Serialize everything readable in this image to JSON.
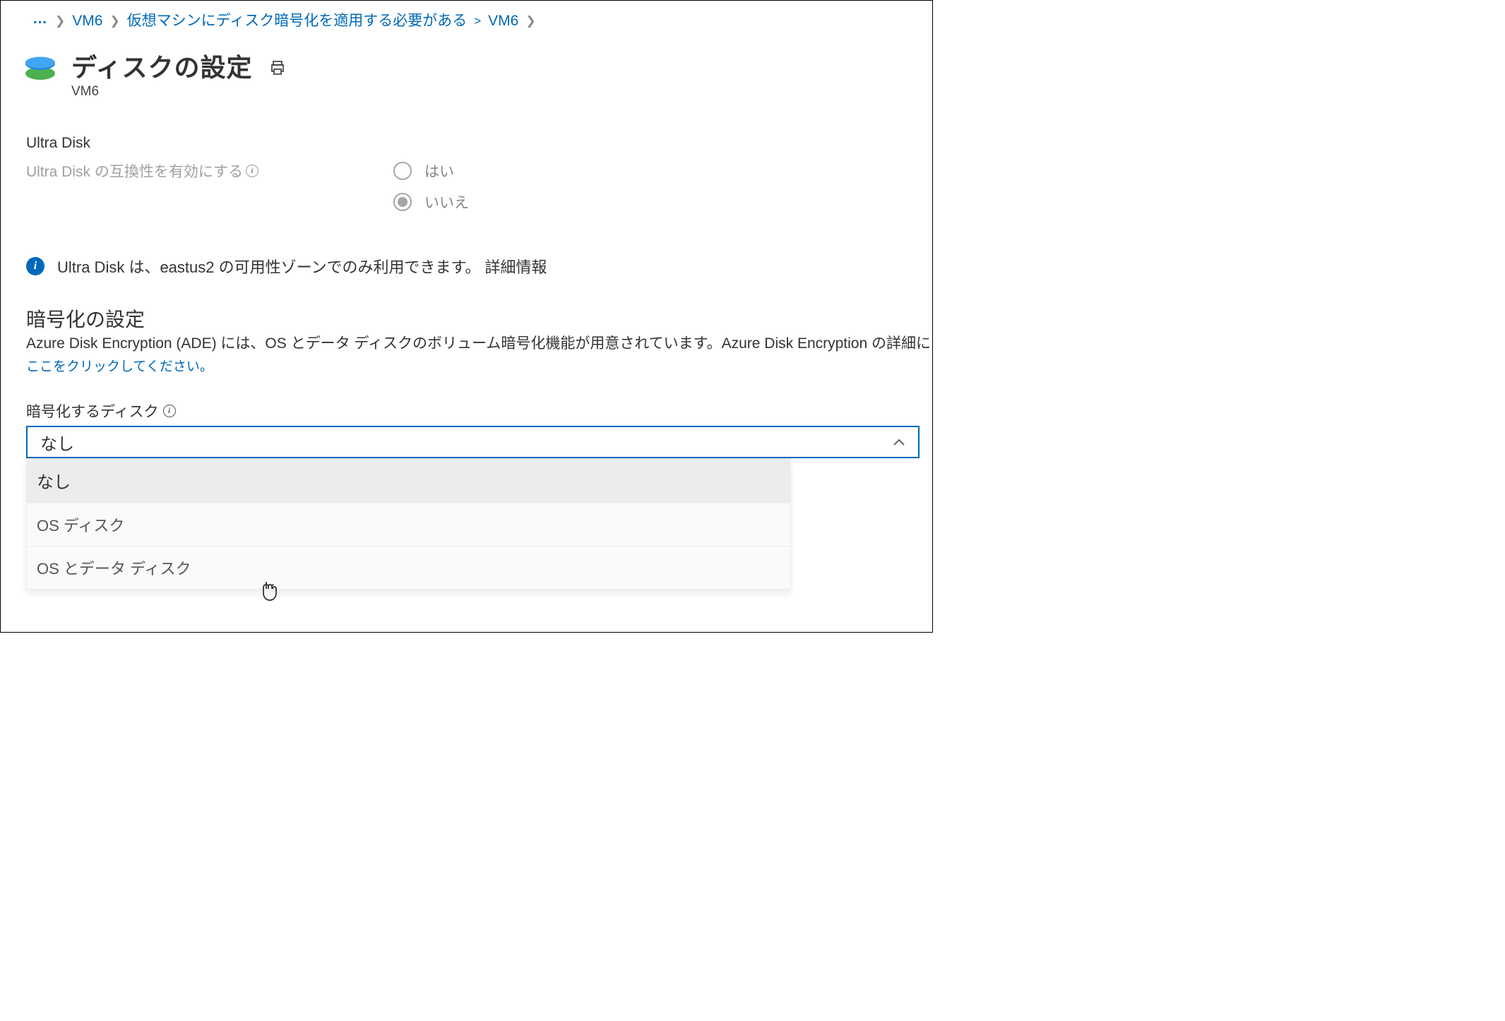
{
  "breadcrumb": {
    "dots": "…",
    "item1": "VM6",
    "item2": "仮想マシンにディスク暗号化を適用する必要がある",
    "item3": "VM6"
  },
  "header": {
    "title": "ディスクの設定",
    "subtitle": "VM6"
  },
  "ultra": {
    "heading": "Ultra Disk",
    "label": "Ultra Disk の互換性を有効にする",
    "yes": "はい",
    "no": "いいえ",
    "selected": "no"
  },
  "info": {
    "text": "Ultra Disk は、eastus2 の可用性ゾーンでのみ利用できます。 詳細情報"
  },
  "encryption": {
    "heading": "暗号化の設定",
    "desc": "Azure Disk Encryption (ADE) には、OS とデータ ディスクのボリューム暗号化機能が用意されています。Azure Disk Encryption の詳細に",
    "link": "ここをクリックしてください。",
    "dd_label": "暗号化するディスク",
    "dd_value": "なし",
    "options": {
      "o0": "なし",
      "o1": "OS ディスク",
      "o2": "OS とデータ ディスク"
    }
  }
}
